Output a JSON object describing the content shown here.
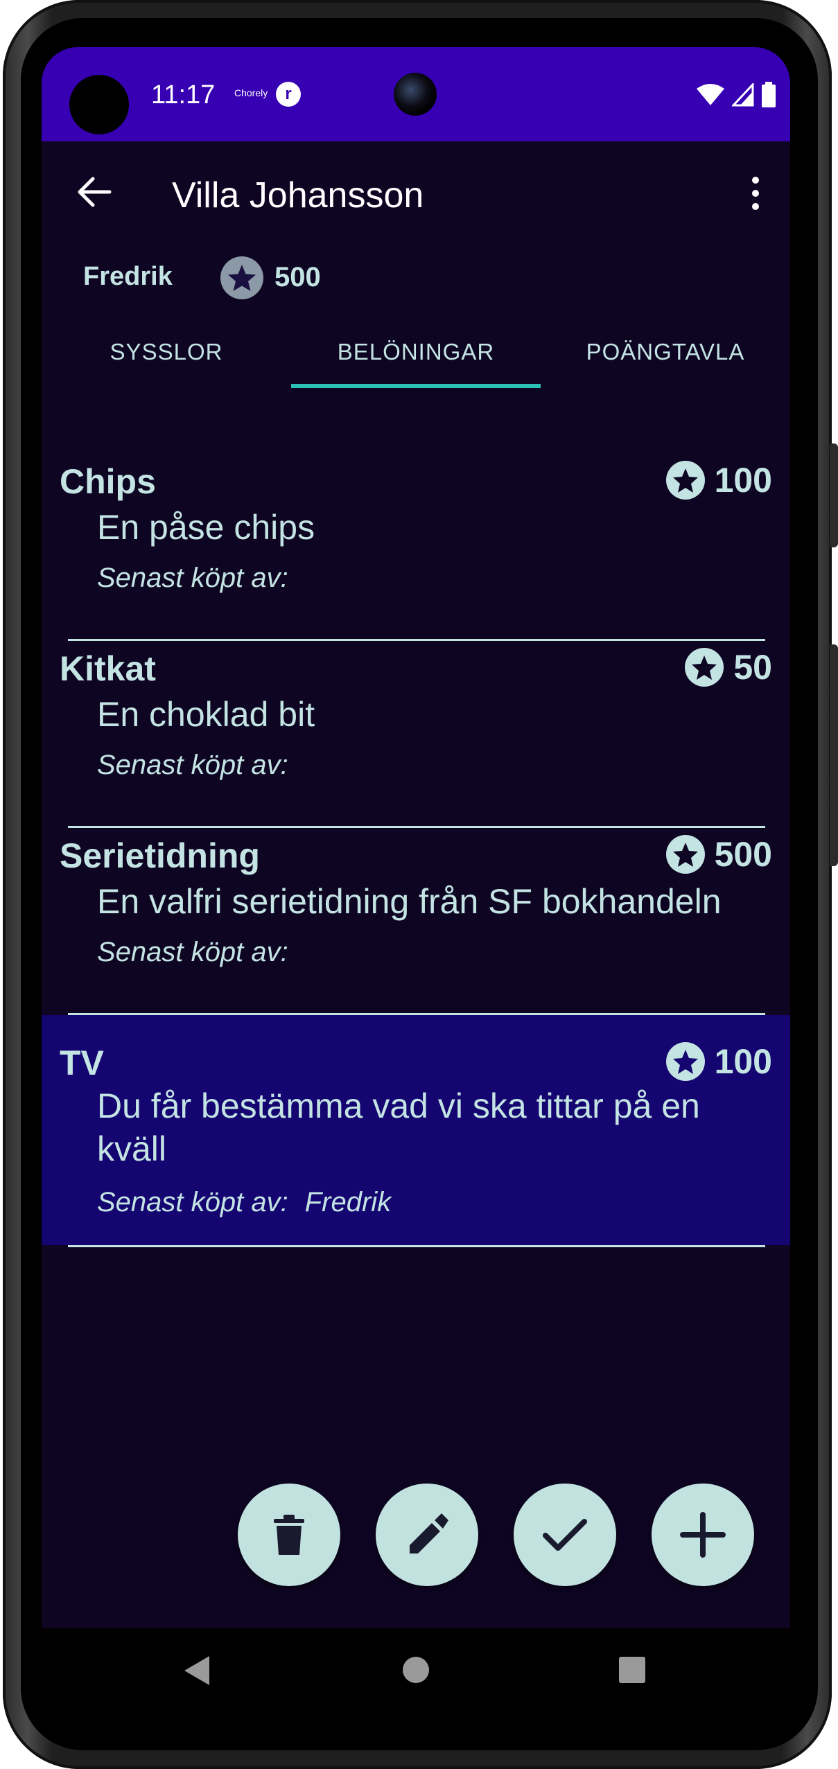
{
  "status_bar": {
    "time": "11:17",
    "notification_app_label": "Chorely",
    "notification_icon_2": "r"
  },
  "app_bar": {
    "title": "Villa Johansson"
  },
  "user": {
    "name": "Fredrik",
    "points": "500"
  },
  "tabs": [
    {
      "label": "SYSSLOR",
      "selected": false
    },
    {
      "label": "BELÖNINGAR",
      "selected": true
    },
    {
      "label": "POÄNGTAVLA",
      "selected": false
    }
  ],
  "rewards": [
    {
      "title": "Chips",
      "points": "100",
      "description": "En påse chips",
      "last_bought_label": "Senast köpt av:",
      "last_bought_by": "",
      "selected": false
    },
    {
      "title": "Kitkat",
      "points": "50",
      "description": "En choklad bit",
      "last_bought_label": "Senast köpt av:",
      "last_bought_by": "",
      "selected": false
    },
    {
      "title": "Serietidning",
      "points": "500",
      "description": "En valfri serietidning från SF bokhandeln",
      "last_bought_label": "Senast köpt av:",
      "last_bought_by": "",
      "selected": false
    },
    {
      "title": "TV",
      "points": "100",
      "description": "Du får bestämma vad vi ska tittar på en kväll",
      "last_bought_label": "Senast köpt av:",
      "last_bought_by": "Fredrik",
      "selected": true
    }
  ],
  "fabs": [
    {
      "icon": "delete-icon"
    },
    {
      "icon": "edit-icon"
    },
    {
      "icon": "check-icon"
    },
    {
      "icon": "add-icon"
    }
  ],
  "colors": {
    "status_bar": "#3700b3",
    "background": "#0e0523",
    "selected_row": "#140570",
    "text": "#c4e4e4",
    "tab_indicator": "#2bc1b8",
    "fab": "#c2e2e0"
  }
}
